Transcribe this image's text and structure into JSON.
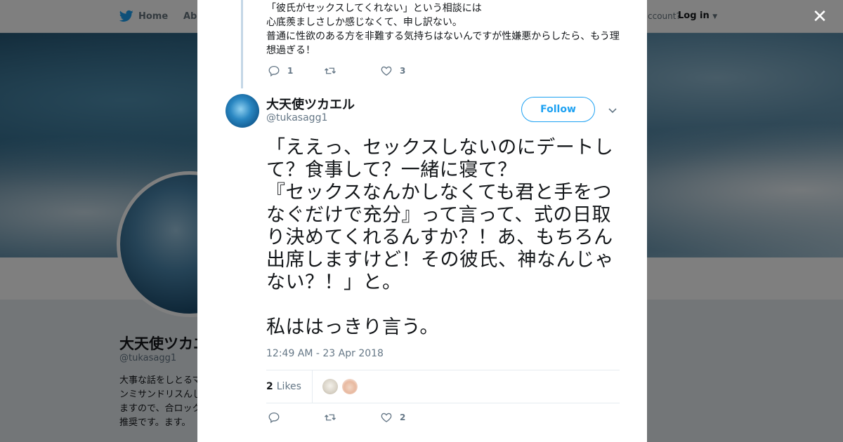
{
  "background": {
    "nav": {
      "home": "Home",
      "about": "Abo",
      "account": "ccount?",
      "login": "Log in"
    },
    "profile": {
      "name": "大天使ツカエ",
      "handle": "@tukasagg1",
      "bio": "大事な話をしとるマンミサンドリスんしますので、合ロック推奨です。ます。"
    }
  },
  "modal": {
    "close_label": "✕",
    "previous_tweet": {
      "text": "「彼氏がセックスしてくれない」という相談には\n心底羨ましさしか感じなくて、申し訳ない。\n普通に性欲のある方を非難する気持ちはないんですが性嫌悪からしたら、もう理想過ぎる！",
      "replies": "1",
      "retweets": "",
      "likes": "3"
    },
    "tweet": {
      "name": "大天使ツカエル",
      "handle": "@tukasagg1",
      "follow_label": "Follow",
      "text": "「ええっ、セックスしないのにデートして？食事して？一緒に寝て？\n『セックスなんかしなくても君と手をつなぐだけで充分』って言って、式の日取り決めてくれるんすか？！あ、もちろん出席しますけど！その彼氏、神なんじゃない？！」と。\n\n私ははっきり言う。",
      "timestamp": "12:49 AM - 23 Apr 2018",
      "likes_number": "2",
      "likes_label": "Likes",
      "replies": "",
      "retweets": "",
      "likes": "2"
    },
    "accent_color": "#1da1f2"
  }
}
